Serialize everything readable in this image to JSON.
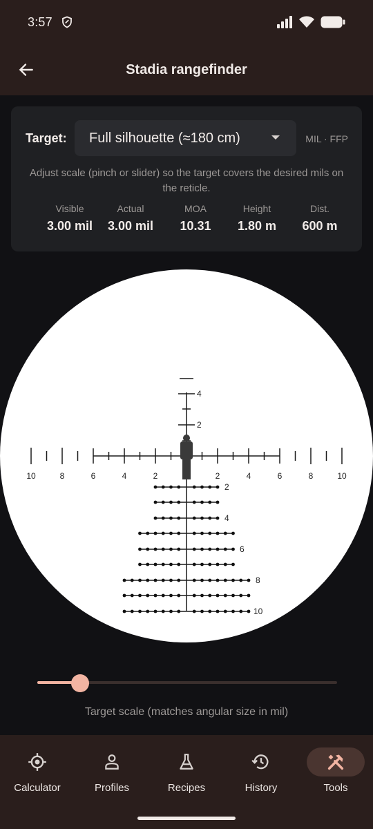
{
  "status": {
    "time": "3:57"
  },
  "app_bar": {
    "title": "Stadia rangefinder"
  },
  "card": {
    "target_label": "Target:",
    "target_value": "Full silhouette (≈180 cm)",
    "mode": "MIL · FFP",
    "hint": "Adjust scale (pinch or slider) so the target covers the desired mils on the reticle.",
    "stats": [
      {
        "label": "Visible",
        "value": "3.00 mil"
      },
      {
        "label": "Actual",
        "value": "3.00 mil"
      },
      {
        "label": "MOA",
        "value": "10.31"
      },
      {
        "label": "Height",
        "value": "1.80 m"
      },
      {
        "label": "Dist.",
        "value": "600 m"
      }
    ]
  },
  "reticle": {
    "horizontal_labels": [
      "10",
      "8",
      "6",
      "4",
      "2",
      "2",
      "4",
      "6",
      "8",
      "10"
    ],
    "vertical_labels": [
      "4",
      "2"
    ],
    "tree_labels": [
      "2",
      "4",
      "6",
      "8",
      "10"
    ]
  },
  "slider": {
    "value": 0.144,
    "caption": "Target scale (matches angular size in mil)",
    "accent_color": "#f2b4a2"
  },
  "nav": {
    "items": [
      {
        "label": "Calculator",
        "icon": "crosshair-icon"
      },
      {
        "label": "Profiles",
        "icon": "person-icon"
      },
      {
        "label": "Recipes",
        "icon": "flask-icon"
      },
      {
        "label": "History",
        "icon": "history-icon"
      },
      {
        "label": "Tools",
        "icon": "tools-icon"
      }
    ],
    "active_index": 4
  }
}
